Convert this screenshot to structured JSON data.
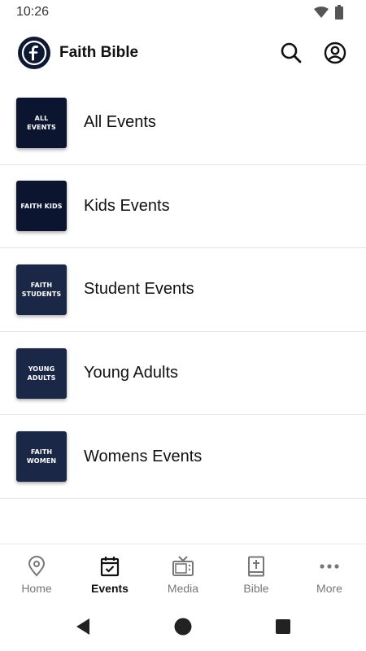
{
  "status_bar": {
    "time": "10:26"
  },
  "header": {
    "title": "Faith Bible",
    "logo_letter": "f"
  },
  "events": [
    {
      "label": "All Events",
      "thumb_text": "ALL EVENTS",
      "thumb_color": "#0b1530"
    },
    {
      "label": "Kids Events",
      "thumb_text": "FAITH KIDS",
      "thumb_color": "#0b1530"
    },
    {
      "label": "Student Events",
      "thumb_text": "FAITH\nSTUDENTS",
      "thumb_color": "#1b2747"
    },
    {
      "label": "Young Adults",
      "thumb_text": "YOUNG\nADULTS",
      "thumb_color": "#1b2747"
    },
    {
      "label": "Womens Events",
      "thumb_text": "FAITH\nWOMEN",
      "thumb_color": "#1b2747"
    }
  ],
  "bottom_nav": [
    {
      "label": "Home",
      "icon": "location-pin-icon",
      "active": false
    },
    {
      "label": "Events",
      "icon": "calendar-check-icon",
      "active": true
    },
    {
      "label": "Media",
      "icon": "tv-icon",
      "active": false
    },
    {
      "label": "Bible",
      "icon": "bible-icon",
      "active": false
    },
    {
      "label": "More",
      "icon": "more-dots-icon",
      "active": false
    }
  ],
  "colors": {
    "brand": "#0e1833",
    "active": "#111111",
    "inactive": "#777777"
  }
}
